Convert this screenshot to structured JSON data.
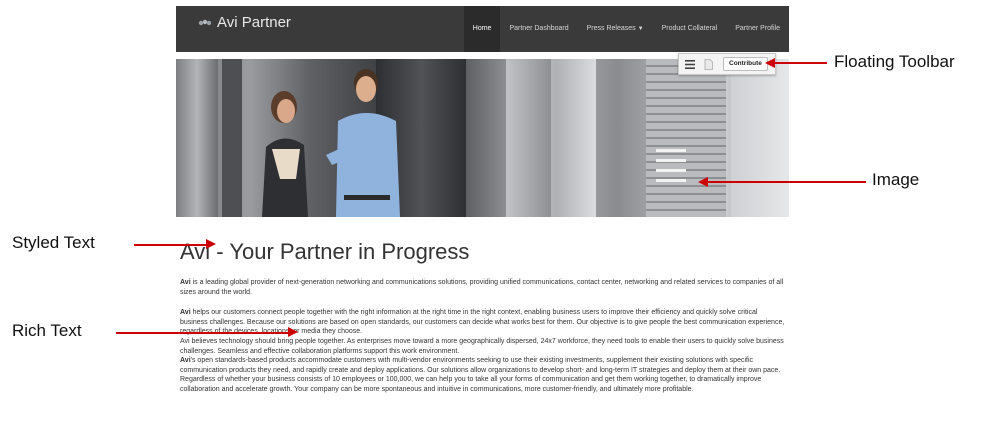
{
  "navbar": {
    "brand": "Avi Partner",
    "items": [
      {
        "label": "Home",
        "active": true
      },
      {
        "label": "Partner Dashboard"
      },
      {
        "label": "Press Releases",
        "has_dropdown": true
      },
      {
        "label": "Product Collateral"
      },
      {
        "label": "Partner Profile"
      }
    ]
  },
  "toolbar": {
    "contribute_label": "Contribute",
    "icons": [
      "menu-icon",
      "page-icon"
    ]
  },
  "content": {
    "title": "Avi - Your Partner in Progress",
    "p1_bold": "Avi",
    "p1_text": " is a leading global provider of next-generation networking and communications solutions, providing unified communications, contact center, networking and related services to companies of all sizes around the world.",
    "p2_bold": "Avi",
    "p2_text": " helps our customers connect people together with the right information at the right time in the right context, enabling business users to improve their efficiency and quickly solve critical business challenges. Because our solutions are based on open standards, our customers can decide what works best for them. Our objective is to give people the best communication experience, regardless of the devices, locations, or media they choose.",
    "p3_text": "Avi believes technology should bring people together. As enterprises move toward a more geographically dispersed, 24x7 workforce, they need tools to enable their users to quickly solve business challenges.  Seamless and effective collaboration platforms support this work environment.",
    "p4_bold": "Avi",
    "p4_text": "'s open standards-based products accommodate customers with multi-vendor environments seeking to use their existing investments, supplement their existing solutions with specific communication products they need, and rapidly create and deploy applications. Our solutions allow organizations to develop short- and long-term IT strategies and deploy them at their own pace.  Regardless of whether your business consists of 10 employees or 100,000, we can help you to take all your forms of communication and get them working together, to dramatically improve collaboration and accelerate growth. Your company can be more spontaneous and intuitive in communications, more customer-friendly, and ultimately more profitable."
  },
  "annotations": {
    "floating_toolbar": "Floating Toolbar",
    "image": "Image",
    "styled_text": "Styled Text",
    "rich_text": "Rich Text"
  },
  "colors": {
    "navbar_bg": "#3a3a3a",
    "arrow": "#cc0000"
  }
}
